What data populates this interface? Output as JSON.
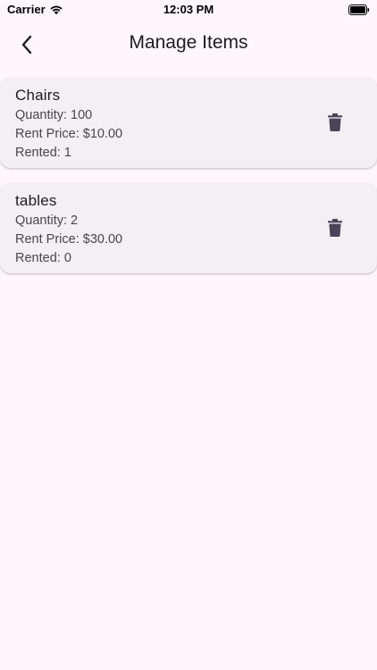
{
  "status_bar": {
    "carrier": "Carrier",
    "time": "12:03 PM"
  },
  "app_bar": {
    "title": "Manage Items",
    "back_icon": "chevron-left-icon"
  },
  "items": [
    {
      "name": "Chairs",
      "quantity_text": "Quantity: 100",
      "price_text": "Rent Price: $10.00",
      "rented_text": "Rented: 1"
    },
    {
      "name": "tables",
      "quantity_text": "Quantity: 2",
      "price_text": "Rent Price: $30.00",
      "rented_text": "Rented: 0"
    }
  ],
  "colors": {
    "background": "#fdf7fd",
    "card": "#f4eff4",
    "icon": "#4a4458"
  }
}
